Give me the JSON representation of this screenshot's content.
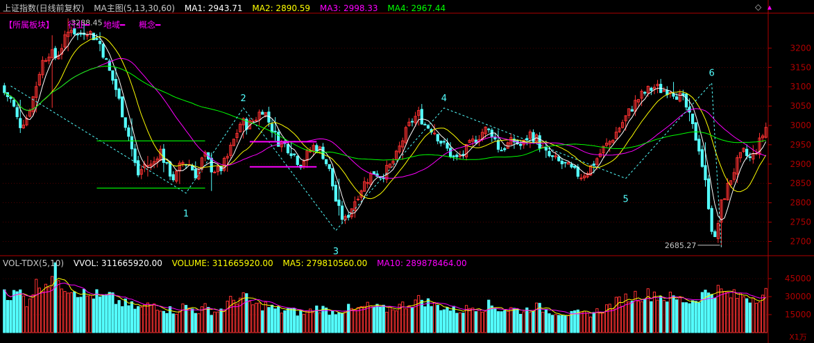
{
  "header": {
    "index_name": "上证指数(日线前复权)",
    "ma_label": "MA主图(5,13,30,60)",
    "ma1": "MA1: 2943.71",
    "ma2": "MA2: 2890.59",
    "ma3": "MA3: 2998.33",
    "ma4": "MA4: 2967.44"
  },
  "categories_bar": [
    "【所属板块】",
    "行业━",
    "地域━",
    "概念━"
  ],
  "volume_header": {
    "name": "VOL-TDX(5,10)",
    "vvol": "VVOL: 311665920.00",
    "volume": "VOLUME: 311665920.00",
    "ma5": "MA5: 279810560.00",
    "ma10": "MA10: 289878464.00"
  },
  "colors": {
    "up": "#ff3232",
    "down": "#54ffff",
    "ma1": "#ffffff",
    "ma2": "#ffff00",
    "ma3": "#ff00ff",
    "ma4": "#00ff00",
    "wave": "#54ffff",
    "grid": "#800000",
    "axis": "#b00000",
    "label": "#c8c8c8",
    "box_green": "#00ff00",
    "box_magenta": "#ff00ff"
  },
  "controls": {
    "diamond_icon": "◇",
    "expand_icon": "▴"
  },
  "chart_data": [
    {
      "type": "candlestick",
      "title": "上证指数(日线前复权)",
      "y_ticks": [
        2700,
        2750,
        2800,
        2850,
        2900,
        2950,
        3000,
        3050,
        3100,
        3150,
        3200
      ],
      "ylim": [
        2665,
        3288.45
      ],
      "annotations": [
        {
          "text": "3288.45",
          "kind": "high",
          "value": 3288.45
        },
        {
          "text": "2685.27",
          "kind": "low",
          "value": 2685.27
        }
      ],
      "wave_labels": [
        {
          "text": "1",
          "value": 2825
        },
        {
          "text": "2",
          "value": 3045
        },
        {
          "text": "3",
          "value": 2728
        },
        {
          "text": "4",
          "value": 3045
        },
        {
          "text": "5",
          "value": 2863
        },
        {
          "text": "6",
          "value": 3110
        }
      ],
      "keypoints": [
        [
          3102,
          3085,
          3110,
          3078
        ],
        [
          3085,
          3064,
          3095,
          3055
        ],
        [
          3064,
          3000,
          3072,
          2988
        ],
        [
          3000,
          3020,
          3035,
          2992
        ],
        [
          3020,
          3080,
          3090,
          3015
        ],
        [
          3080,
          3160,
          3165,
          3075
        ],
        [
          3160,
          3190,
          3210,
          3150
        ],
        [
          3190,
          3175,
          3260,
          2925
        ],
        [
          3175,
          3215,
          3288,
          3170
        ],
        [
          3215,
          3255,
          3270,
          3205
        ],
        [
          3255,
          3230,
          3265,
          3225
        ],
        [
          3230,
          3250,
          3260,
          3220
        ],
        [
          3250,
          3232,
          3255,
          3215
        ],
        [
          3232,
          3210,
          3240,
          3190
        ],
        [
          3210,
          3150,
          3215,
          3130
        ],
        [
          3150,
          3100,
          3155,
          3080
        ],
        [
          3100,
          3030,
          3105,
          3010
        ],
        [
          3030,
          2960,
          3035,
          2940
        ],
        [
          2960,
          2870,
          2965,
          2855
        ],
        [
          2870,
          2900,
          2925,
          2860
        ],
        [
          2900,
          2895,
          2915,
          2880
        ],
        [
          2895,
          2940,
          2960,
          2890
        ],
        [
          2940,
          2890,
          2945,
          2870
        ],
        [
          2890,
          2860,
          2895,
          2845
        ],
        [
          2860,
          2905,
          2915,
          2850
        ],
        [
          2905,
          2900,
          2920,
          2880
        ],
        [
          2900,
          2870,
          2905,
          2860
        ],
        [
          2870,
          2925,
          2930,
          2865
        ],
        [
          2925,
          2890,
          2930,
          2830
        ],
        [
          2890,
          2880,
          2895,
          2870
        ],
        [
          2880,
          2910,
          2920,
          2875
        ],
        [
          2910,
          2960,
          2965,
          2905
        ],
        [
          2960,
          3010,
          3015,
          2955
        ],
        [
          3010,
          3000,
          3015,
          2990
        ],
        [
          3000,
          3020,
          3025,
          2990
        ],
        [
          3020,
          3045,
          3050,
          3010
        ],
        [
          3045,
          3000,
          3050,
          2995
        ],
        [
          3000,
          2960,
          3005,
          2940
        ],
        [
          2960,
          2950,
          2970,
          2940
        ],
        [
          2950,
          2930,
          2955,
          2920
        ],
        [
          2930,
          2900,
          2940,
          2895
        ],
        [
          2900,
          2925,
          2935,
          2890
        ],
        [
          2925,
          2950,
          2955,
          2920
        ],
        [
          2950,
          2930,
          2955,
          2915
        ],
        [
          2930,
          2880,
          2935,
          2870
        ],
        [
          2880,
          2790,
          2885,
          2780
        ],
        [
          2790,
          2750,
          2795,
          2728
        ],
        [
          2750,
          2790,
          2800,
          2745
        ],
        [
          2790,
          2830,
          2840,
          2785
        ],
        [
          2830,
          2860,
          2870,
          2825
        ],
        [
          2860,
          2880,
          2890,
          2855
        ],
        [
          2880,
          2870,
          2895,
          2860
        ],
        [
          2870,
          2890,
          2900,
          2860
        ],
        [
          2890,
          2920,
          2925,
          2885
        ],
        [
          2920,
          2970,
          2975,
          2915
        ],
        [
          2970,
          3010,
          3020,
          2965
        ],
        [
          3010,
          3030,
          3045,
          3000
        ],
        [
          3030,
          3000,
          3035,
          2990
        ],
        [
          3000,
          2990,
          3005,
          2980
        ],
        [
          2990,
          2960,
          2995,
          2950
        ],
        [
          2960,
          2935,
          2965,
          2925
        ],
        [
          2935,
          2910,
          2940,
          2895
        ],
        [
          2910,
          2925,
          2935,
          2900
        ],
        [
          2925,
          2950,
          2955,
          2920
        ],
        [
          2950,
          2970,
          2975,
          2945
        ],
        [
          2970,
          2990,
          2995,
          2965
        ],
        [
          2990,
          2980,
          2998,
          2950
        ],
        [
          2980,
          2935,
          2985,
          2925
        ],
        [
          2935,
          2950,
          2955,
          2930
        ],
        [
          2950,
          2960,
          2965,
          2940
        ],
        [
          2960,
          2945,
          2965,
          2935
        ],
        [
          2945,
          2980,
          2990,
          2940
        ],
        [
          2980,
          2965,
          2985,
          2955
        ],
        [
          2965,
          2930,
          2970,
          2920
        ],
        [
          2930,
          2915,
          2935,
          2905
        ],
        [
          2915,
          2905,
          2920,
          2895
        ],
        [
          2905,
          2895,
          2910,
          2885
        ],
        [
          2895,
          2880,
          2900,
          2870
        ],
        [
          2880,
          2870,
          2885,
          2863
        ],
        [
          2870,
          2885,
          2890,
          2865
        ],
        [
          2885,
          2910,
          2915,
          2880
        ],
        [
          2910,
          2940,
          2945,
          2905
        ],
        [
          2940,
          2960,
          2965,
          2935
        ],
        [
          2960,
          2990,
          3000,
          2955
        ],
        [
          2990,
          3020,
          3025,
          2985
        ],
        [
          3020,
          3050,
          3060,
          3015
        ],
        [
          3050,
          3075,
          3085,
          3045
        ],
        [
          3075,
          3090,
          3100,
          3070
        ],
        [
          3090,
          3100,
          3110,
          3085
        ],
        [
          3100,
          3090,
          3110,
          3080
        ],
        [
          3090,
          3095,
          3125,
          3085
        ],
        [
          3095,
          3080,
          3100,
          3075
        ],
        [
          3080,
          3060,
          3085,
          3050
        ],
        [
          3060,
          3000,
          3062,
          2990
        ],
        [
          3000,
          2940,
          3005,
          2935
        ],
        [
          2940,
          2830,
          2945,
          2820
        ],
        [
          2830,
          2690,
          2835,
          2685
        ],
        [
          2690,
          2800,
          2805,
          2685
        ],
        [
          2800,
          2850,
          2860,
          2795
        ],
        [
          2850,
          2900,
          2910,
          2845
        ],
        [
          2900,
          2930,
          2940,
          2895
        ],
        [
          2930,
          2910,
          2945,
          2900
        ],
        [
          2910,
          2950,
          2960,
          2905
        ],
        [
          2950,
          2995,
          3000,
          2945
        ]
      ]
    },
    {
      "type": "bar",
      "title": "VOL-TDX(5,10)",
      "y_ticks": [
        15000,
        30000,
        45000
      ],
      "unit": "X1万",
      "ylim": [
        0,
        52000
      ],
      "keypoints": [
        36000,
        30000,
        34000,
        26000,
        38000,
        42000,
        44000,
        50000,
        40000,
        38000,
        35000,
        30000,
        32000,
        28000,
        30000,
        26000,
        24000,
        22000,
        20000,
        22000,
        24000,
        21000,
        19000,
        18000,
        22000,
        20000,
        18000,
        21000,
        17000,
        19000,
        25000,
        28000,
        30000,
        24000,
        22000,
        23000,
        20000,
        18000,
        19000,
        17000,
        16000,
        18000,
        21000,
        19000,
        17000,
        19000,
        20000,
        18000,
        21000,
        22000,
        20000,
        19000,
        21000,
        22000,
        24000,
        26000,
        28000,
        24000,
        22000,
        21000,
        19000,
        18000,
        20000,
        22000,
        21000,
        23000,
        20000,
        19000,
        20000,
        18000,
        19000,
        22000,
        20000,
        18000,
        17000,
        16000,
        15000,
        16000,
        15000,
        17000,
        19000,
        22000,
        25000,
        28000,
        30000,
        32000,
        31000,
        33000,
        30000,
        29000,
        28000,
        27000,
        26000,
        30000,
        33000,
        36000,
        34000,
        31000,
        30000,
        31000,
        29000,
        31000,
        33000
      ]
    }
  ]
}
